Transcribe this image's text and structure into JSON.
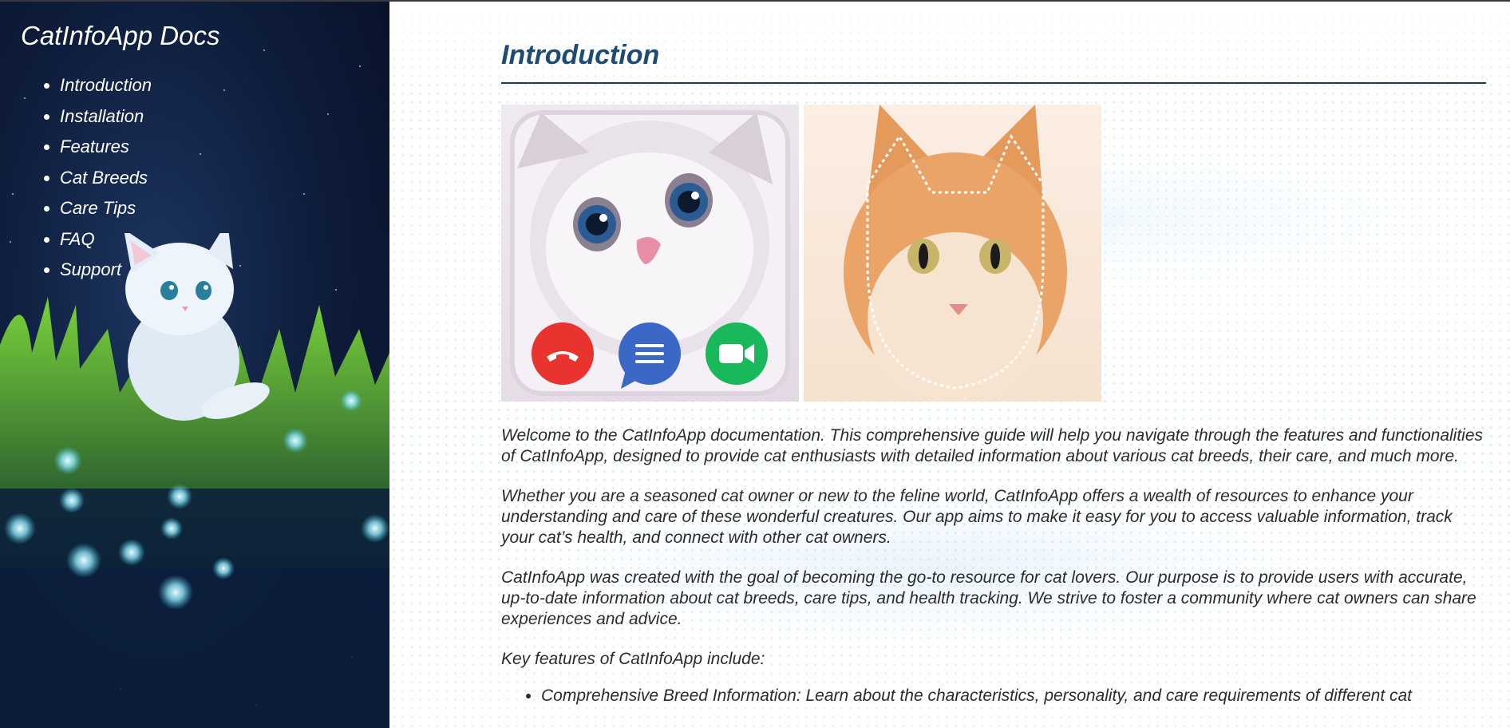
{
  "sidebar": {
    "title": "CatInfoApp Docs",
    "nav": [
      {
        "label": "Introduction"
      },
      {
        "label": "Installation"
      },
      {
        "label": "Features"
      },
      {
        "label": "Cat Breeds"
      },
      {
        "label": "Care Tips"
      },
      {
        "label": "FAQ"
      },
      {
        "label": "Support"
      }
    ]
  },
  "main": {
    "title": "Introduction",
    "paragraphs": [
      "Welcome to the CatInfoApp documentation. This comprehensive guide will help you navigate through the features and functionalities of CatInfoApp, designed to provide cat enthusiasts with detailed information about various cat breeds, their care, and much more.",
      "Whether you are a seasoned cat owner or new to the feline world, CatInfoApp offers a wealth of resources to enhance your understanding and care of these wonderful creatures. Our app aims to make it easy for you to access valuable information, track your cat’s health, and connect with other cat owners.",
      "CatInfoApp was created with the goal of becoming the go-to resource for cat lovers. Our purpose is to provide users with accurate, up-to-date information about cat breeds, care tips, and health tracking. We strive to foster a community where cat owners can share experiences and advice.",
      "Key features of CatInfoApp include:"
    ],
    "features": [
      "Comprehensive Breed Information: Learn about the characteristics, personality, and care requirements of different cat"
    ]
  },
  "colors": {
    "title": "#1e4a73",
    "rule": "#1e3a5f",
    "sidebar_bg": "#0f1f3f",
    "call_end": "#e8332f",
    "chat": "#3b68c6",
    "video": "#19b85a"
  },
  "icons": [
    "phone-hangup-icon",
    "chat-icon",
    "video-camera-icon"
  ]
}
